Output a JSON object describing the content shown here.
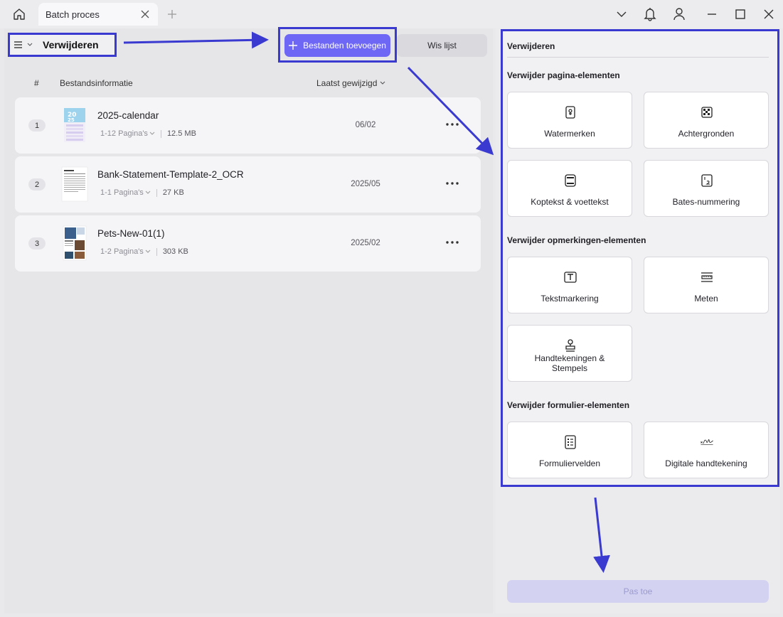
{
  "titlebar": {
    "tab_title": "Batch proces"
  },
  "toolbar": {
    "mode_title": "Verwijderen",
    "add_files_label": "Bestanden toevoegen",
    "clear_list_label": "Wis lijst"
  },
  "file_table": {
    "columns": {
      "number": "#",
      "info": "Bestandsinformatie",
      "modified": "Laatst gewijzigd"
    },
    "rows": [
      {
        "num": "1",
        "name": "2025-calendar",
        "pages": "1-12 Pagina's",
        "size": "12.5 MB",
        "date": "06/02"
      },
      {
        "num": "2",
        "name": "Bank-Statement-Template-2_OCR",
        "pages": "1-1 Pagina's",
        "size": "27 KB",
        "date": "2025/05"
      },
      {
        "num": "3",
        "name": "Pets-New-01(1)",
        "pages": "1-2 Pagina's",
        "size": "303 KB",
        "date": "2025/02"
      }
    ]
  },
  "right_panel": {
    "title": "Verwijderen",
    "sections": [
      {
        "title": "Verwijder pagina-elementen",
        "options": [
          {
            "label": "Watermerken",
            "icon": "watermark-icon"
          },
          {
            "label": "Achtergronden",
            "icon": "background-icon"
          },
          {
            "label": "Koptekst & voettekst",
            "icon": "header-footer-icon"
          },
          {
            "label": "Bates-nummering",
            "icon": "bates-numbering-icon"
          }
        ]
      },
      {
        "title": "Verwijder opmerkingen-elementen",
        "options": [
          {
            "label": "Tekstmarkering",
            "icon": "text-markup-icon"
          },
          {
            "label": "Meten",
            "icon": "measure-icon"
          },
          {
            "label": "Handtekeningen & Stempels",
            "icon": "stamp-icon"
          }
        ]
      },
      {
        "title": "Verwijder formulier-elementen",
        "options": [
          {
            "label": "Formuliervelden",
            "icon": "form-fields-icon"
          },
          {
            "label": "Digitale handtekening",
            "icon": "digital-signature-icon"
          }
        ]
      }
    ],
    "apply_label": "Pas toe"
  },
  "colors": {
    "accent": "#6e67f5",
    "annotation": "#3a3ad0",
    "apply_disabled": "#d4d2f1"
  }
}
